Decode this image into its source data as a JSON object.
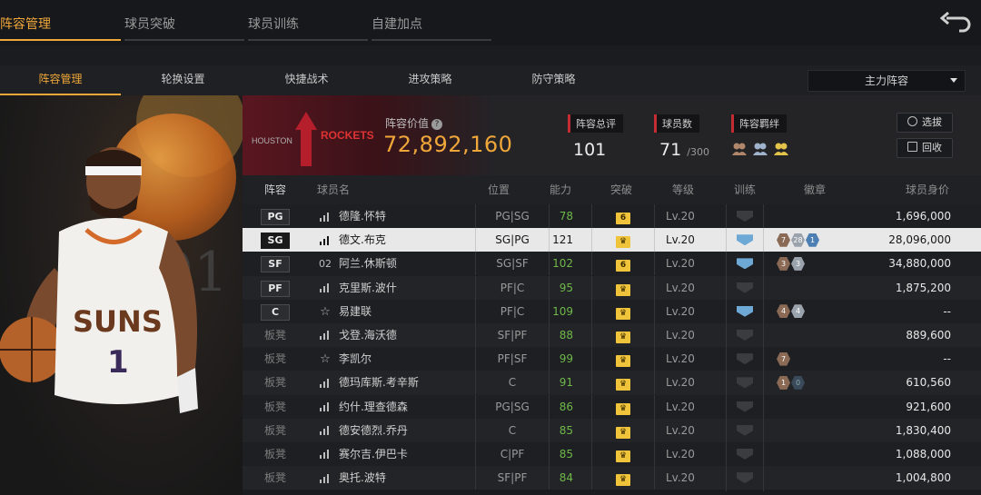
{
  "top_tabs": [
    {
      "label": "阵容管理",
      "active": true
    },
    {
      "label": "球员突破",
      "active": false
    },
    {
      "label": "球员训练",
      "active": false
    },
    {
      "label": "自建加点",
      "active": false
    }
  ],
  "sub_tabs": [
    {
      "label": "阵容管理",
      "active": true
    },
    {
      "label": "轮换设置",
      "active": false
    },
    {
      "label": "快捷战术",
      "active": false
    },
    {
      "label": "进攻策略",
      "active": false
    },
    {
      "label": "防守策略",
      "active": false
    }
  ],
  "lineup_select": {
    "value": "主力阵容"
  },
  "team": {
    "logo_text_left": "HOUSTON",
    "logo_text_right": "ROCKETS",
    "value_label": "阵容价值",
    "value": "72,892,160",
    "rating_label": "阵容总评",
    "rating": "101",
    "count_label": "球员数",
    "count": "71",
    "count_max": "/300",
    "bond_label": "阵容羁绊"
  },
  "buttons": {
    "select": "选拔",
    "recycle": "回收"
  },
  "columns": {
    "lineup": "阵容",
    "name": "球员名",
    "position": "位置",
    "ability": "能力",
    "breakthrough": "突破",
    "level": "等级",
    "training": "训练",
    "emblem": "徽章",
    "value": "球员身价"
  },
  "players": [
    {
      "slot": "PG",
      "starter": true,
      "icon": "bars",
      "name": "德隆.怀特",
      "pos": "PG|SG",
      "ability": "78",
      "brk": "6",
      "level": "Lv.20",
      "train": "grey",
      "emblems": [],
      "price": "1,696,000",
      "selected": false
    },
    {
      "slot": "SG",
      "starter": true,
      "icon": "bars",
      "name": "德文.布克",
      "pos": "SG|PG",
      "ability": "121",
      "brk": "crown",
      "level": "Lv.20",
      "train": "blue",
      "emblems": [
        {
          "t": "bronze",
          "v": "7"
        },
        {
          "t": "silver",
          "v": "28"
        },
        {
          "t": "blue",
          "v": "1"
        }
      ],
      "price": "28,096,000",
      "selected": true
    },
    {
      "slot": "SF",
      "starter": true,
      "icon": "02",
      "name": "阿兰.休斯顿",
      "pos": "SG|SF",
      "ability": "102",
      "brk": "6",
      "level": "Lv.20",
      "train": "blue3",
      "emblems": [
        {
          "t": "bronze",
          "v": "3"
        },
        {
          "t": "silver",
          "v": "3"
        }
      ],
      "price": "34,880,000",
      "selected": false
    },
    {
      "slot": "PF",
      "starter": true,
      "icon": "bars",
      "name": "克里斯.波什",
      "pos": "PF|C",
      "ability": "95",
      "brk": "crown",
      "level": "Lv.20",
      "train": "grey",
      "emblems": [],
      "price": "1,875,200",
      "selected": false
    },
    {
      "slot": "C",
      "starter": true,
      "icon": "star",
      "name": "易建联",
      "pos": "PF|C",
      "ability": "109",
      "brk": "crown",
      "level": "Lv.20",
      "train": "blue",
      "emblems": [
        {
          "t": "bronze",
          "v": "4"
        },
        {
          "t": "silver",
          "v": "4"
        }
      ],
      "price": "--",
      "selected": false
    },
    {
      "slot": "板凳",
      "starter": false,
      "icon": "bars",
      "name": "戈登.海沃德",
      "pos": "SF|PF",
      "ability": "88",
      "brk": "crown",
      "level": "Lv.20",
      "train": "grey",
      "emblems": [],
      "price": "889,600",
      "selected": false
    },
    {
      "slot": "板凳",
      "starter": false,
      "icon": "star",
      "name": "李凯尔",
      "pos": "PF|SF",
      "ability": "99",
      "brk": "crown",
      "level": "Lv.20",
      "train": "grey",
      "emblems": [
        {
          "t": "bronze",
          "v": "7"
        }
      ],
      "price": "--",
      "selected": false
    },
    {
      "slot": "板凳",
      "starter": false,
      "icon": "bars",
      "name": "德玛库斯.考辛斯",
      "pos": "C",
      "ability": "91",
      "brk": "crown",
      "level": "Lv.20",
      "train": "grey",
      "emblems": [
        {
          "t": "bronze",
          "v": "1"
        },
        {
          "t": "dark",
          "v": "0"
        }
      ],
      "price": "610,560",
      "selected": false
    },
    {
      "slot": "板凳",
      "starter": false,
      "icon": "bars",
      "name": "约什.理查德森",
      "pos": "PG|SG",
      "ability": "86",
      "brk": "crown",
      "level": "Lv.20",
      "train": "grey",
      "emblems": [],
      "price": "921,600",
      "selected": false
    },
    {
      "slot": "板凳",
      "starter": false,
      "icon": "bars",
      "name": "德安德烈.乔丹",
      "pos": "C",
      "ability": "85",
      "brk": "crown",
      "level": "Lv.20",
      "train": "grey",
      "emblems": [],
      "price": "1,830,400",
      "selected": false
    },
    {
      "slot": "板凳",
      "starter": false,
      "icon": "bars",
      "name": "赛尔吉.伊巴卡",
      "pos": "C|PF",
      "ability": "85",
      "brk": "crown",
      "level": "Lv.20",
      "train": "grey",
      "emblems": [],
      "price": "1,088,000",
      "selected": false
    },
    {
      "slot": "板凳",
      "starter": false,
      "icon": "bars",
      "name": "奥托.波特",
      "pos": "SF|PF",
      "ability": "84",
      "brk": "crown",
      "level": "Lv.20",
      "train": "grey",
      "emblems": [],
      "price": "1,004,800",
      "selected": false
    }
  ],
  "art": {
    "jersey_text": "SUNS",
    "jersey_number": "1",
    "bg_text": "01"
  }
}
